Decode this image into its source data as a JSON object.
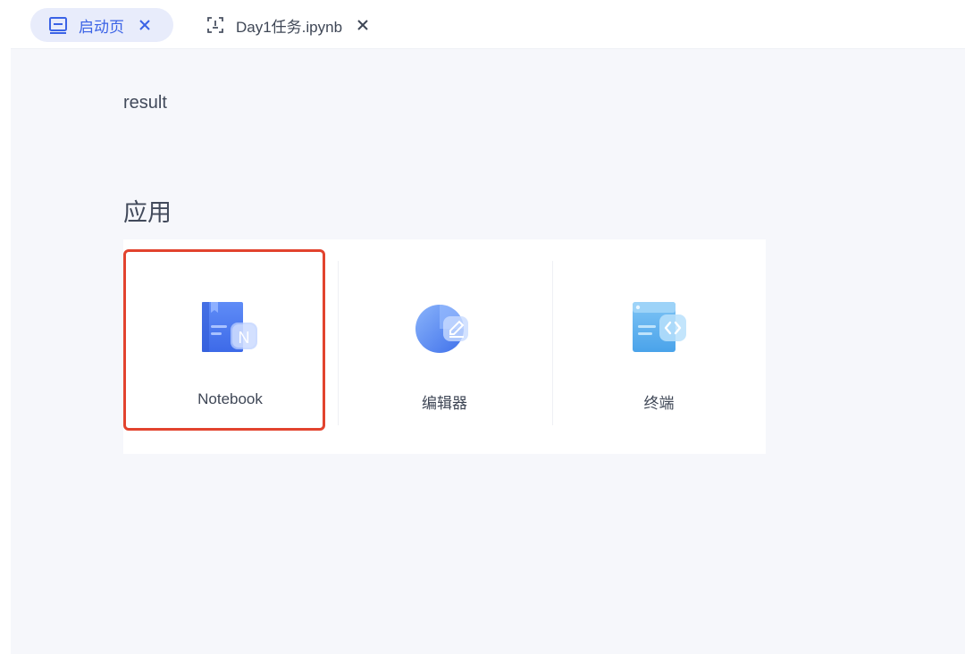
{
  "tabs": [
    {
      "label": "启动页",
      "icon": "launcher-icon",
      "active": true
    },
    {
      "label": "Day1任务.ipynb",
      "icon": "notebook-file-icon",
      "active": false
    }
  ],
  "main": {
    "section_result": "result",
    "section_apps": "应用",
    "apps": [
      {
        "label": "Notebook",
        "icon": "notebook-icon"
      },
      {
        "label": "编辑器",
        "icon": "editor-icon"
      },
      {
        "label": "终端",
        "icon": "terminal-icon"
      }
    ]
  },
  "colors": {
    "accent": "#3b63e6",
    "active_tab_bg": "#e8ecfb",
    "highlight_border": "#e2432e",
    "page_bg": "#f6f7fb"
  }
}
